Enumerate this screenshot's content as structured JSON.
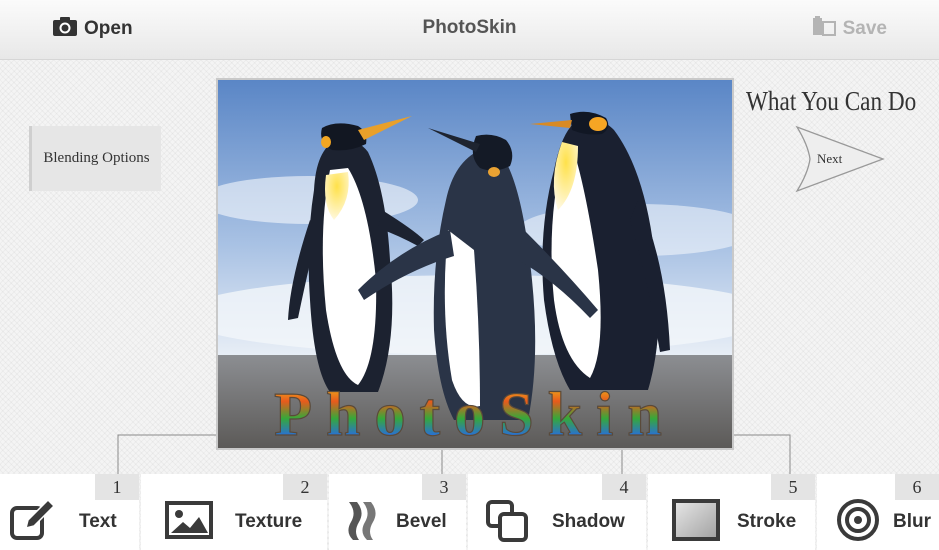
{
  "topbar": {
    "open_label": "Open",
    "app_title": "PhotoSkin",
    "save_label": "Save"
  },
  "sidebar": {
    "blending_options_label": "Blending Options"
  },
  "canvas": {
    "overlay_text": "PhotoSkin"
  },
  "help": {
    "title": "What You Can Do",
    "next_label": "Next"
  },
  "tools": [
    {
      "number": "1",
      "label": "Text",
      "icon": "text-edit-icon"
    },
    {
      "number": "2",
      "label": "Texture",
      "icon": "image-icon"
    },
    {
      "number": "3",
      "label": "Bevel",
      "icon": "bevel-icon"
    },
    {
      "number": "4",
      "label": "Shadow",
      "icon": "shadow-icon"
    },
    {
      "number": "5",
      "label": "Stroke",
      "icon": "stroke-icon"
    },
    {
      "number": "6",
      "label": "Blur",
      "icon": "blur-icon"
    }
  ],
  "colors": {
    "background": "#f4f4f4",
    "topbar": "#eeeeee",
    "text_dark": "#333333",
    "save_disabled": "#b4b4b4",
    "tool_number_bg": "#e4e4e4"
  }
}
